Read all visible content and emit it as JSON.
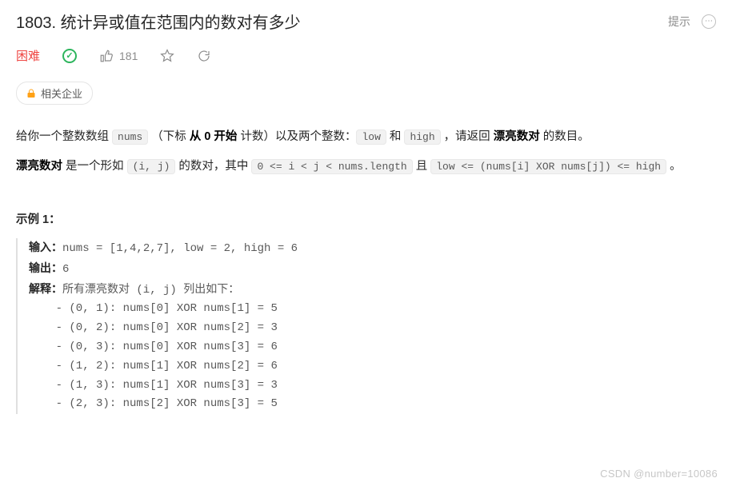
{
  "header": {
    "title": "1803. 统计异或值在范围内的数对有多少",
    "hint": "提示"
  },
  "meta": {
    "difficulty": "困难",
    "likes": "181"
  },
  "company": {
    "label": "相关企业"
  },
  "para1": {
    "t1": "给你一个整数数组 ",
    "c1": "nums",
    "t2": " （下标 ",
    "b1": "从 0 开始",
    "t3": " 计数）以及两个整数：",
    "c2": "low",
    "t4": " 和 ",
    "c3": "high",
    "t5": " ，请返回 ",
    "b2": "漂亮数对",
    "t6": " 的数目。"
  },
  "para2": {
    "b1": "漂亮数对",
    "t1": " 是一个形如 ",
    "c1": "(i, j)",
    "t2": " 的数对，其中 ",
    "c2": "0 <= i < j < nums.length",
    "t3": " 且 ",
    "c3": "low <= (nums[i] XOR nums[j]) <= high",
    "t4": " 。"
  },
  "example": {
    "title": "示例 1：",
    "labels": {
      "input": "输入：",
      "output": "输出：",
      "explain": "解释："
    },
    "input": "nums = [1,4,2,7], low = 2, high = 6",
    "output": "6",
    "explain_head": "所有漂亮数对 (i, j) 列出如下：",
    "lines": [
      "    - (0, 1): nums[0] XOR nums[1] = 5",
      "    - (0, 2): nums[0] XOR nums[2] = 3",
      "    - (0, 3): nums[0] XOR nums[3] = 6",
      "    - (1, 2): nums[1] XOR nums[2] = 6",
      "    - (1, 3): nums[1] XOR nums[3] = 3",
      "    - (2, 3): nums[2] XOR nums[3] = 5"
    ]
  },
  "watermark": "CSDN @number=10086"
}
